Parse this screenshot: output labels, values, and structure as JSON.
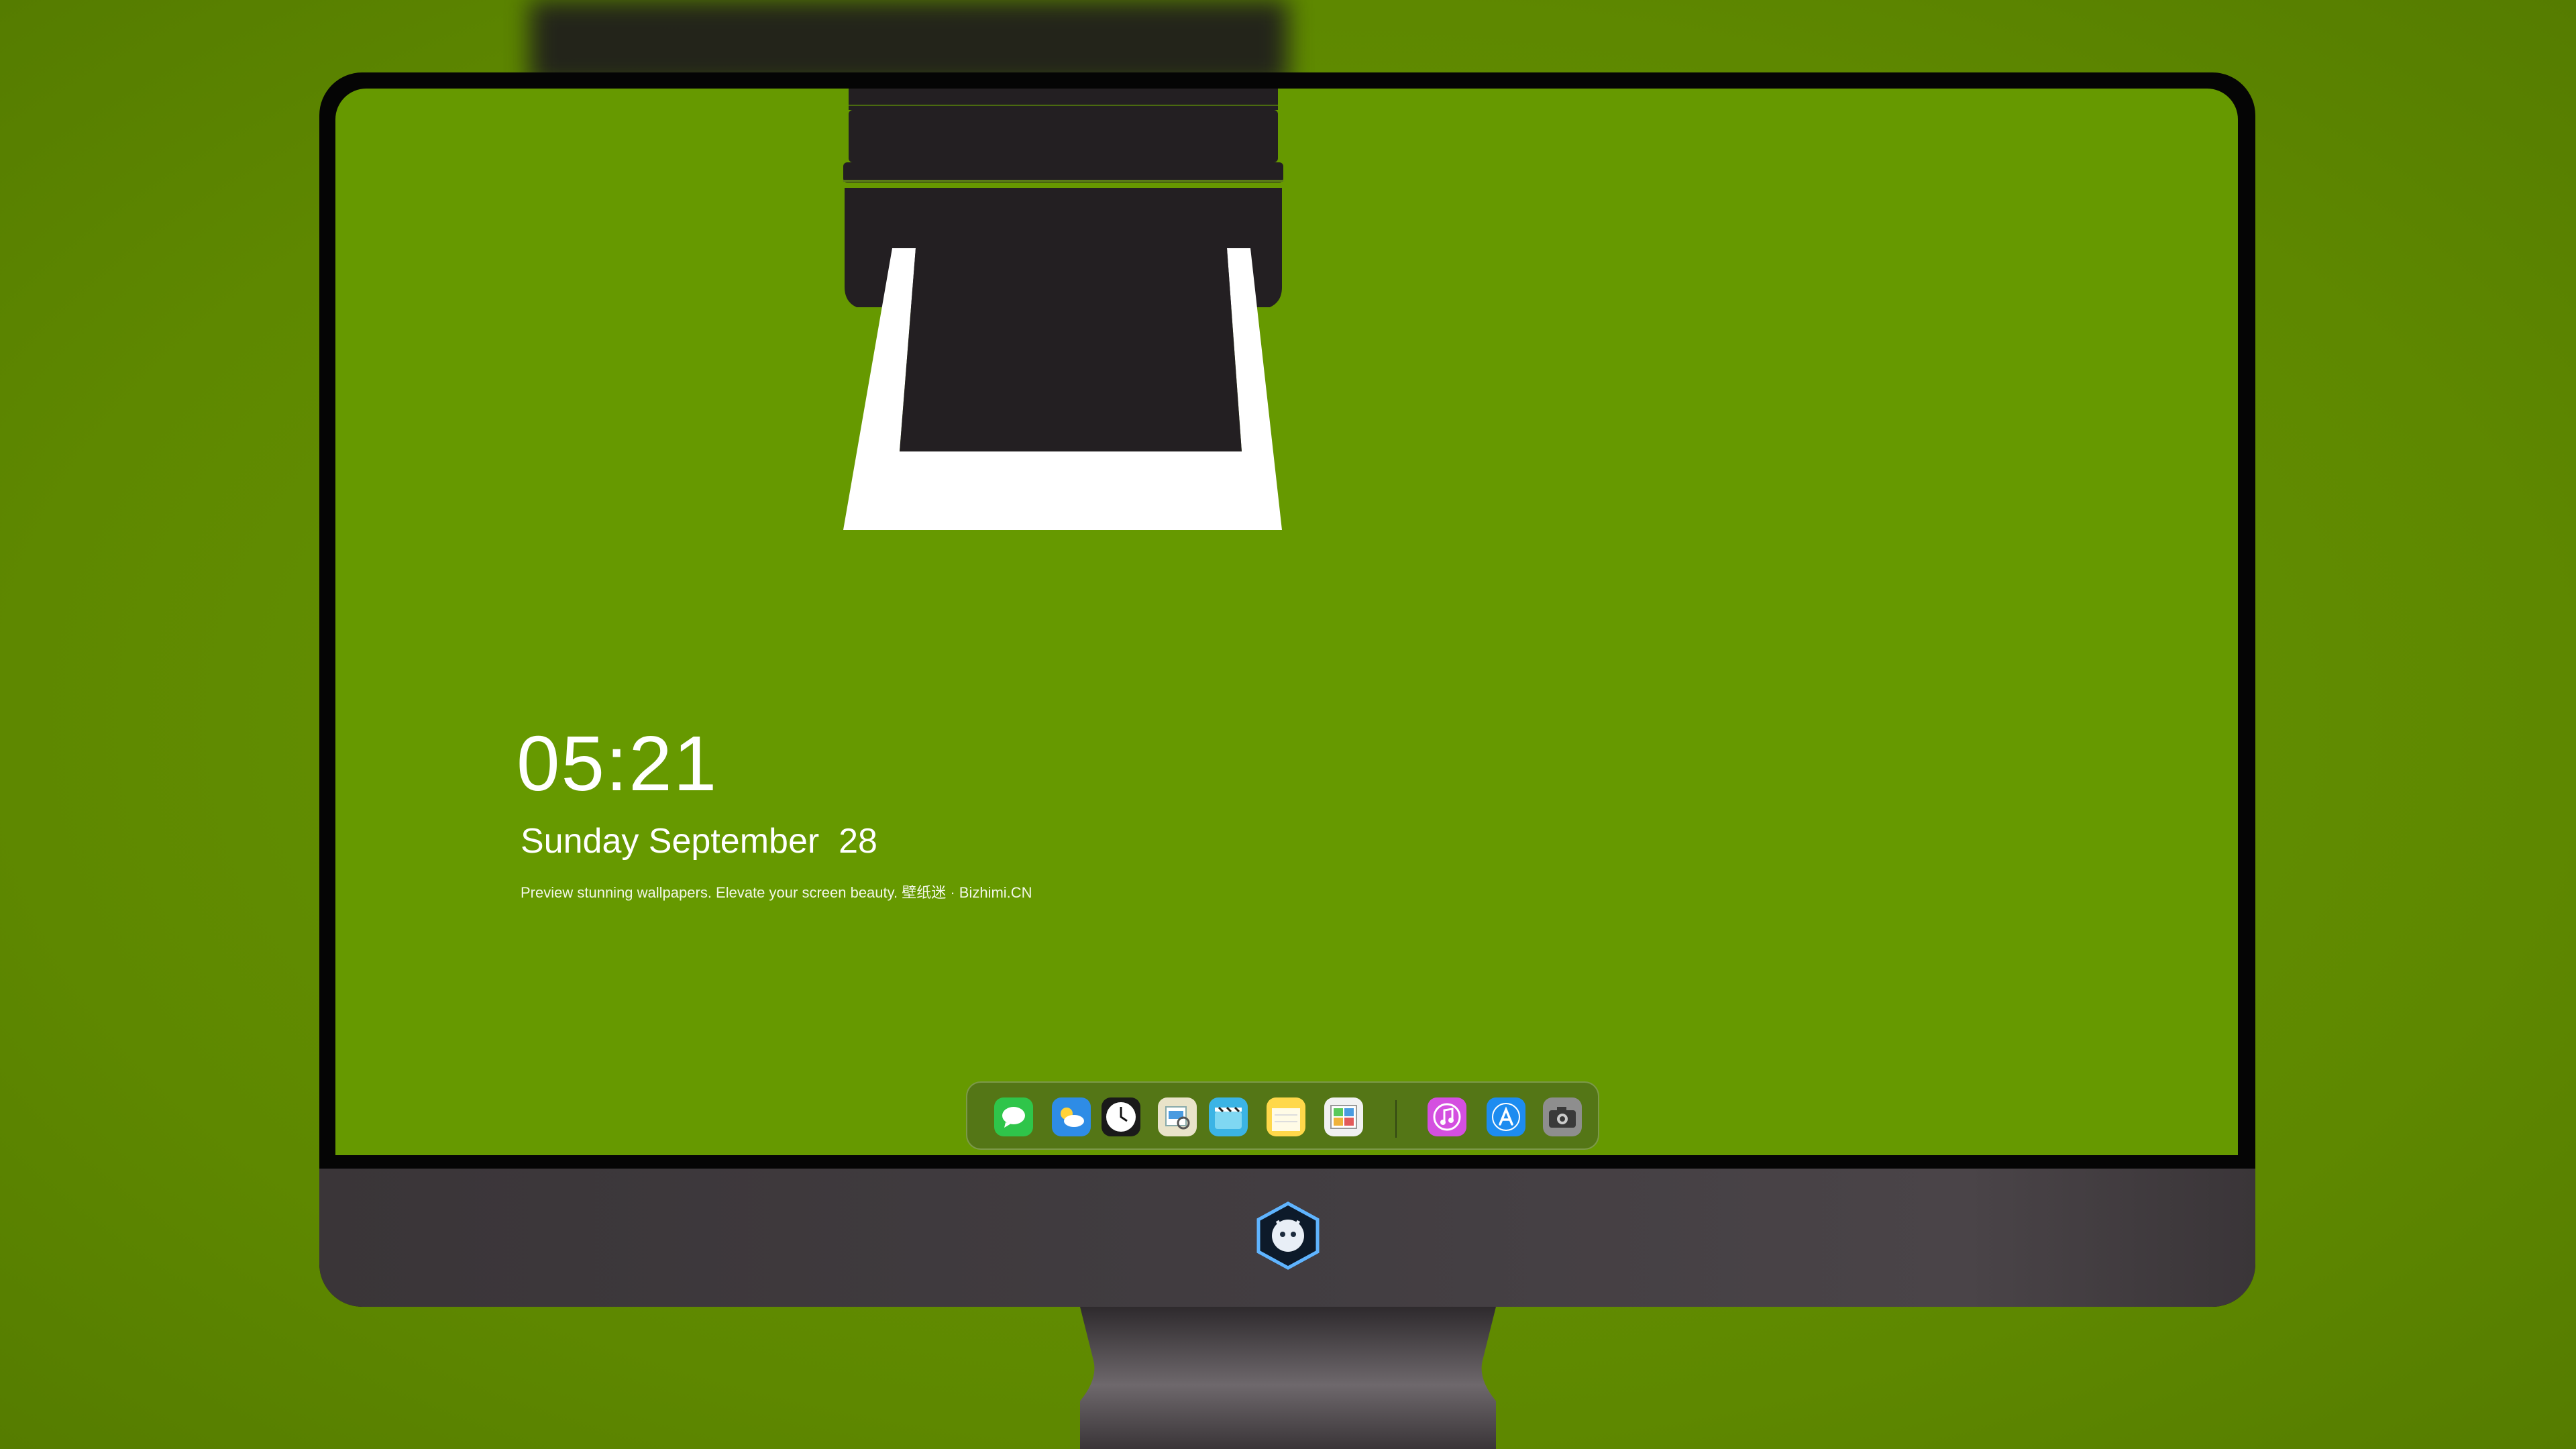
{
  "lock_screen": {
    "time": "05:21",
    "date": "Sunday September  28",
    "caption": "Preview stunning wallpapers. Elevate your screen beauty. 壁纸迷 · Bizhimi.CN"
  },
  "dock": {
    "apps": [
      {
        "icon": "messages-icon",
        "color": "#2fc54a"
      },
      {
        "icon": "weather-icon",
        "color": "#2e8ce6"
      },
      {
        "icon": "clock-icon",
        "color": "#1a1a1a"
      },
      {
        "icon": "preview-icon",
        "color": "#e9e3c9"
      },
      {
        "icon": "clips-icon",
        "color": "#3bb4e5"
      },
      {
        "icon": "notes-icon",
        "color": "#ffd84a"
      },
      {
        "icon": "photo-booth-icon",
        "color": "#f1f1f1"
      },
      {
        "icon": "itunes-icon",
        "color": "#d44fe0"
      },
      {
        "icon": "app-store-icon",
        "color": "#1d8cf0"
      },
      {
        "icon": "camera-icon",
        "color": "#8e8e8e"
      }
    ]
  },
  "colors": {
    "wallpaper": "#669900",
    "printer_body": "#231f22",
    "paper": "#ffffff"
  }
}
